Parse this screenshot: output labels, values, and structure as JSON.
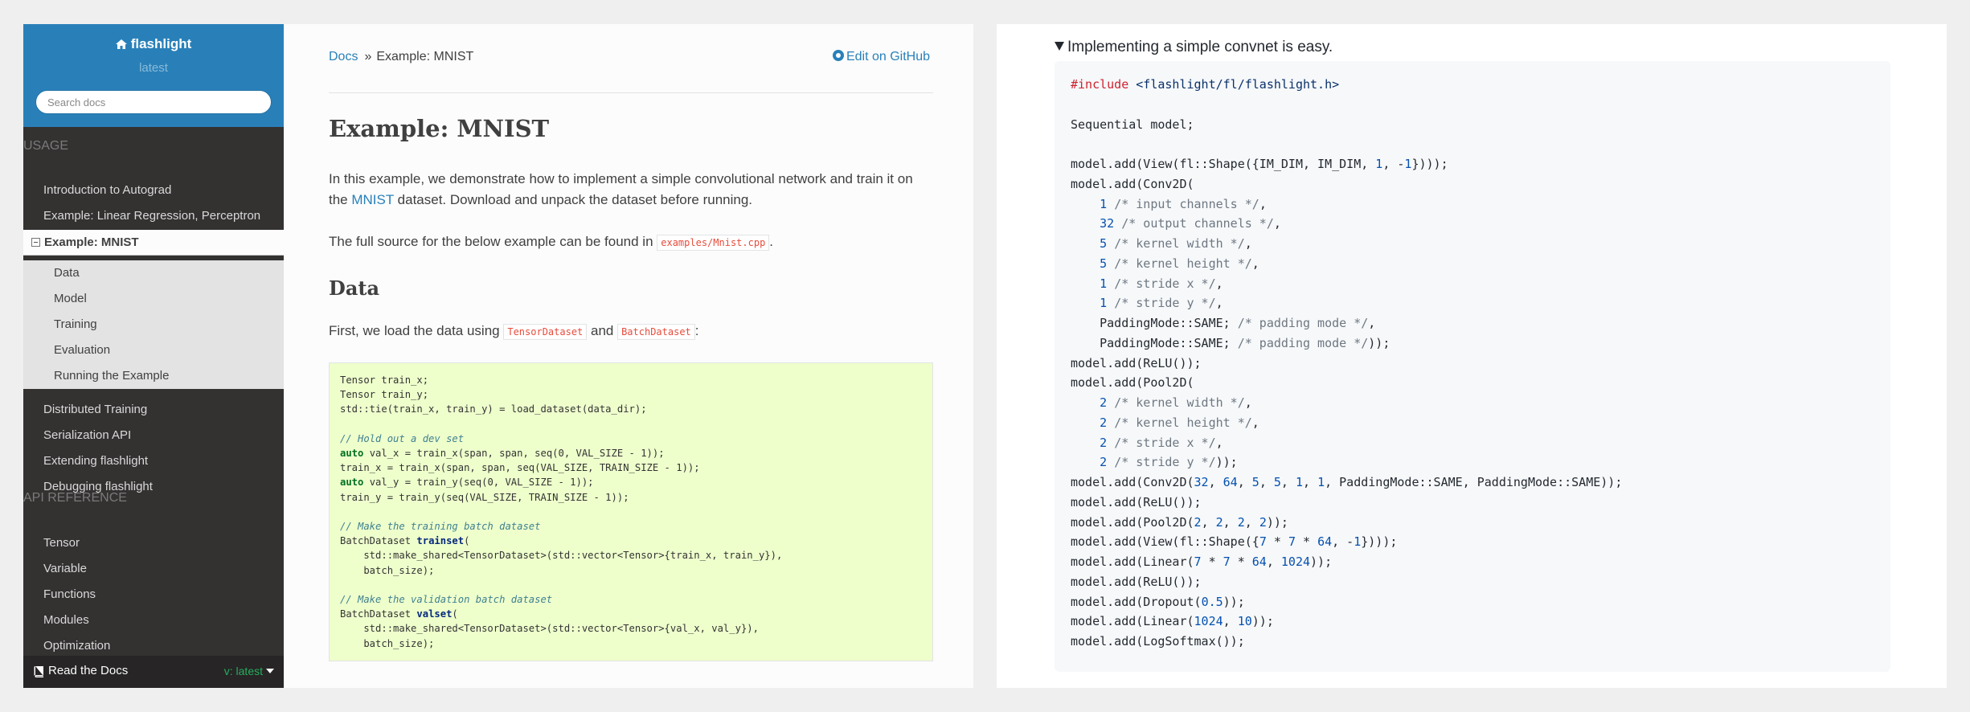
{
  "sidebar": {
    "brand": "flashlight",
    "version": "latest",
    "search_placeholder": "Search docs",
    "caption_usage": "USAGE",
    "caption_api": "API REFERENCE",
    "usage_items": [
      "Introduction to Autograd",
      "Example: Linear Regression, Perceptron",
      "Example: MNIST",
      "Distributed Training",
      "Serialization API",
      "Extending flashlight",
      "Debugging flashlight"
    ],
    "mnist_subitems": [
      "Data",
      "Model",
      "Training",
      "Evaluation",
      "Running the Example"
    ],
    "api_items": [
      "Tensor",
      "Variable",
      "Functions",
      "Modules",
      "Optimization"
    ],
    "footer": {
      "label": "Read the Docs",
      "version": "v: latest"
    }
  },
  "content": {
    "breadcrumb_root": "Docs",
    "breadcrumb_sep": "»",
    "breadcrumb_current": "Example: MNIST",
    "edit_link": "Edit on GitHub",
    "title": "Example: MNIST",
    "intro_part1": "In this example, we demonstrate how to implement a simple convolutional network and train it on",
    "intro_the": "the ",
    "intro_link": "MNIST",
    "intro_part2": " dataset. Download and unpack the dataset before running.",
    "source_text": "The full source for the below example can be found in ",
    "source_file": "examples/Mnist.cpp",
    "data_heading": "Data",
    "data_text_1": "First, we load the data using ",
    "data_code_1": "TensorDataset",
    "data_text_and": " and ",
    "data_code_2": "BatchDataset",
    "data_text_end": ":"
  },
  "right": {
    "summary": "Implementing a simple convnet is easy."
  },
  "colors": {
    "accent": "#2980b9",
    "sidebar_bg": "#343131",
    "code_bg_left": "#eeffcc",
    "code_bg_right": "#f6f8fa"
  }
}
